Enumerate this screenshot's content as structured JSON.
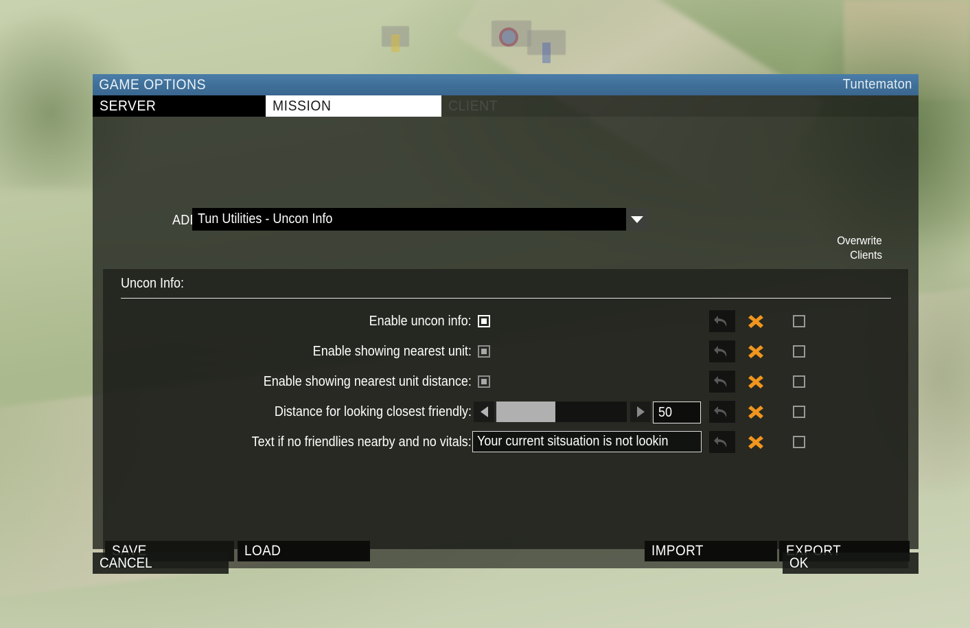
{
  "window": {
    "title": "GAME OPTIONS",
    "user": "Tuntematon"
  },
  "tabs": [
    {
      "label": "SERVER",
      "state": "inactive"
    },
    {
      "label": "MISSION",
      "state": "active"
    },
    {
      "label": "CLIENT",
      "state": "disabled"
    }
  ],
  "addon": {
    "label": "ADDON:",
    "value": "Tun Utilities - Uncon Info",
    "arrow_icon": "chevron-down-icon"
  },
  "columns": {
    "overwrite_line1": "Overwrite",
    "overwrite_line2": "Clients"
  },
  "section": {
    "title": "Uncon Info:"
  },
  "icons": {
    "undo": "undo-icon",
    "reset": "x-reset-icon",
    "slider_left": "arrow-left-icon",
    "slider_right": "arrow-right-icon"
  },
  "colors": {
    "accent_blue": "#3f6f98",
    "reset_orange": "#f0951e",
    "active_tab_bg": "#ffffff",
    "panel_bg": "#161814"
  },
  "rows": [
    {
      "label": "Enable uncon info:",
      "control": "checkbox",
      "checked": true,
      "focused": true,
      "overwrite_checked": false
    },
    {
      "label": "Enable showing nearest unit:",
      "control": "checkbox",
      "checked": true,
      "focused": false,
      "overwrite_checked": false
    },
    {
      "label": "Enable showing nearest unit distance:",
      "control": "checkbox",
      "checked": true,
      "focused": false,
      "overwrite_checked": false
    },
    {
      "label": "Distance for looking closest friendly:",
      "control": "slider",
      "value": "50",
      "fill_percent": 45,
      "overwrite_checked": false
    },
    {
      "label": "Text if no friendlies nearby and no vitals:",
      "control": "text",
      "value": "Your current sitsuation is not lookin",
      "overwrite_checked": false
    }
  ],
  "buttons": {
    "save": "SAVE",
    "load": "LOAD",
    "import": "IMPORT",
    "export": "EXPORT",
    "cancel": "CANCEL",
    "ok": "OK"
  }
}
